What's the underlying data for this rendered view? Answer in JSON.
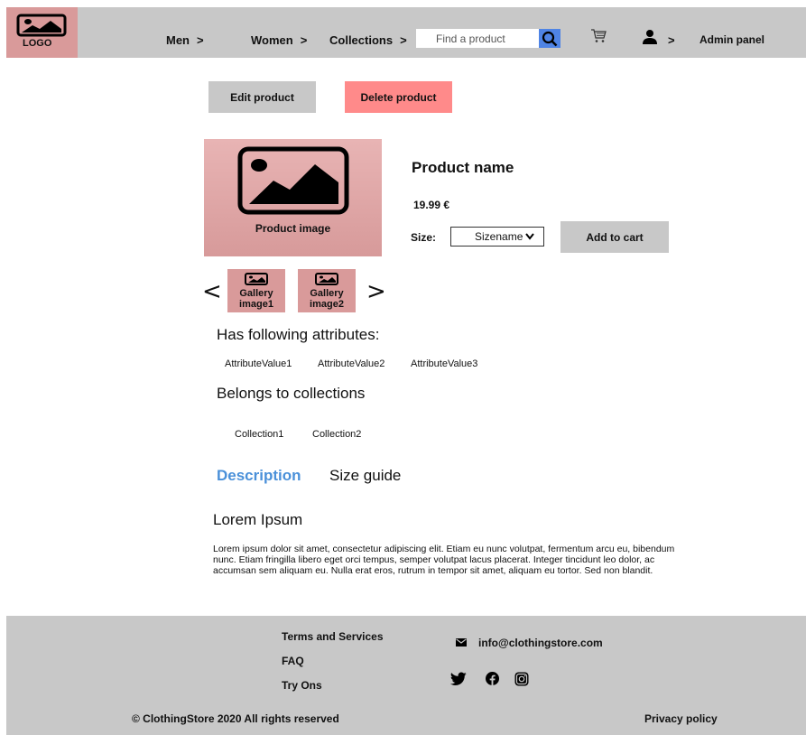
{
  "header": {
    "logo_text": "LOGO",
    "nav": [
      {
        "label": "Men",
        "chevron": ">"
      },
      {
        "label": "Women",
        "chevron": ">"
      },
      {
        "label": "Collections",
        "chevron": ">"
      }
    ],
    "search_placeholder": "Find a product",
    "user_chevron": ">",
    "admin_label": "Admin panel"
  },
  "actions": {
    "edit_label": "Edit product",
    "delete_label": "Delete product"
  },
  "product": {
    "image_label": "Product image",
    "name": "Product name",
    "price": "19.99 €",
    "size_label": "Size:",
    "size_value": "Sizename",
    "add_to_cart_label": "Add to cart"
  },
  "gallery": {
    "prev": "<",
    "next": ">",
    "images": [
      {
        "line1": "Gallery",
        "line2": "image1"
      },
      {
        "line1": "Gallery",
        "line2": "image2"
      }
    ]
  },
  "attributes": {
    "title": "Has following attributes:",
    "values": [
      "AttributeValue1",
      "AttributeValue2",
      "AttributeValue3"
    ]
  },
  "collections": {
    "title": "Belongs to collections",
    "values": [
      "Collection1",
      "Collection2"
    ]
  },
  "tabs": [
    {
      "label": "Description",
      "active": true
    },
    {
      "label": "Size guide",
      "active": false
    }
  ],
  "description": {
    "title": "Lorem Ipsum",
    "body": "Lorem ipsum dolor sit amet, consectetur adipiscing elit. Etiam eu nunc volutpat, fermentum arcu eu, bibendum nunc. Etiam fringilla libero eget orci tempus, semper volutpat lacus placerat. Integer tincidunt leo dolor, ac accumsan sem aliquam eu. Nulla erat eros, rutrum in tempor sit amet, aliquam eu tortor. Sed non blandit."
  },
  "footer": {
    "links": [
      "Terms and Services",
      "FAQ",
      "Try Ons"
    ],
    "email": "info@clothingstore.com",
    "social": [
      "twitter-icon",
      "facebook-icon",
      "instagram-icon"
    ],
    "copyright": "© ClothingStore 2020 All rights reserved",
    "privacy": "Privacy policy"
  },
  "colors": {
    "header_bg": "#c8c8c8",
    "logo_bg": "#d99a9a",
    "delete_bg": "#ff8a8a",
    "search_btn": "#4f84e5",
    "tab_active": "#4a90d9"
  }
}
